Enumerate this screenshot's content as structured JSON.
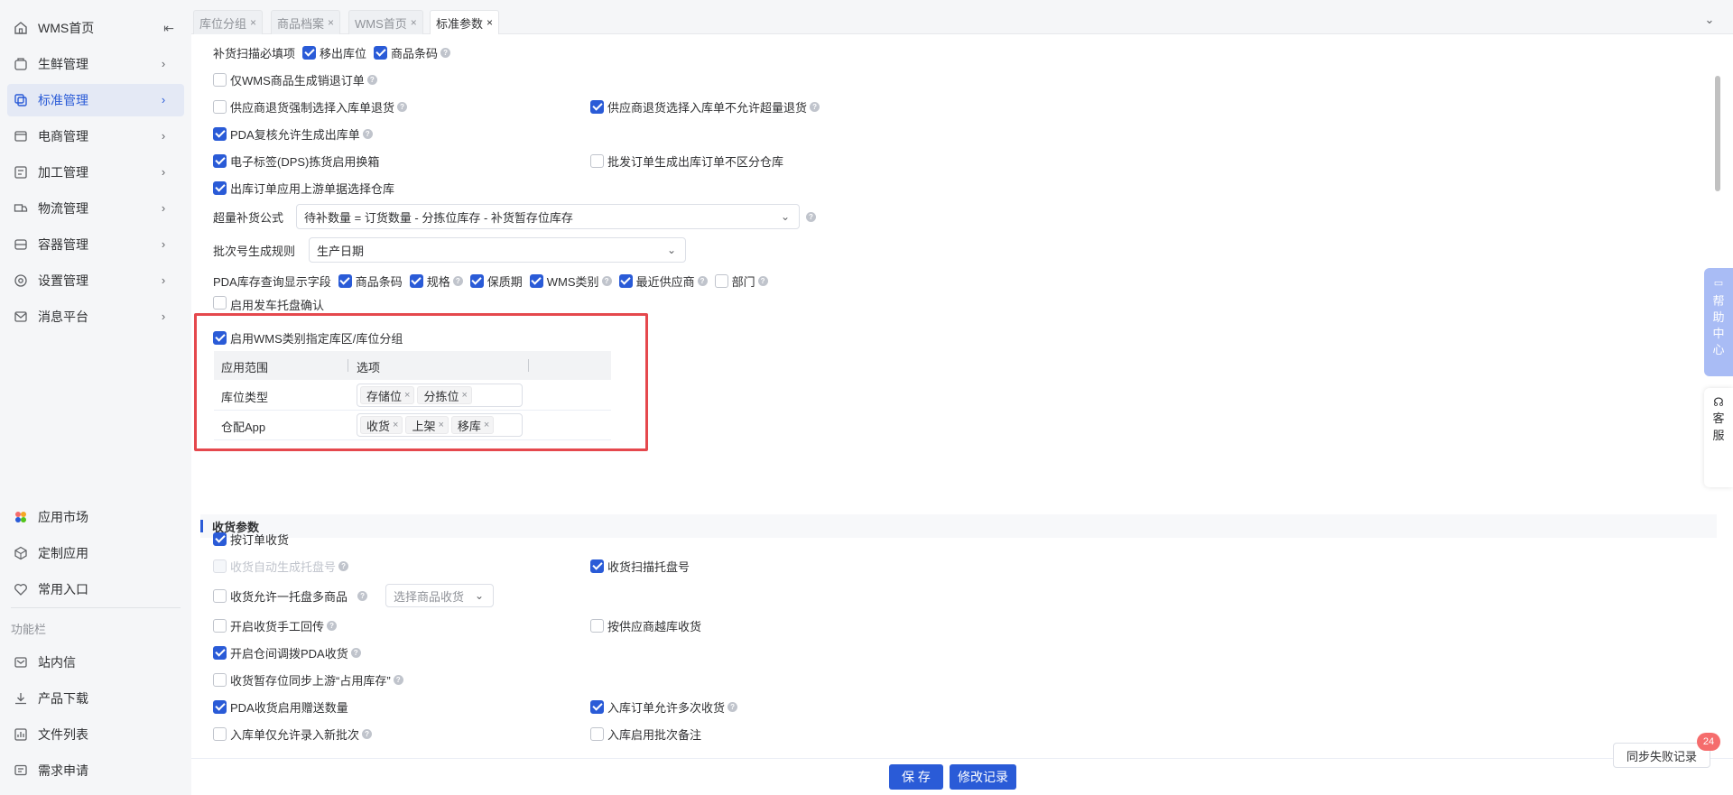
{
  "sidebar": {
    "home": "WMS首页",
    "items": [
      {
        "label": "生鲜管理",
        "icon": "leaf-icon"
      },
      {
        "label": "标准管理",
        "icon": "copy-icon",
        "active": true
      },
      {
        "label": "电商管理",
        "icon": "shop-icon"
      },
      {
        "label": "加工管理",
        "icon": "process-icon"
      },
      {
        "label": "物流管理",
        "icon": "truck-icon"
      },
      {
        "label": "容器管理",
        "icon": "container-icon"
      },
      {
        "label": "设置管理",
        "icon": "settings-icon"
      },
      {
        "label": "消息平台",
        "icon": "mail-icon"
      }
    ],
    "bottom_items": [
      {
        "label": "应用市场",
        "icon": "app-market-icon"
      },
      {
        "label": "定制应用",
        "icon": "cube-icon"
      },
      {
        "label": "常用入口",
        "icon": "heart-icon"
      }
    ],
    "section_title": "功能栏",
    "func_items": [
      {
        "label": "站内信",
        "icon": "inbox-icon"
      },
      {
        "label": "产品下载",
        "icon": "download-icon"
      },
      {
        "label": "文件列表",
        "icon": "chart-file-icon"
      },
      {
        "label": "需求申请",
        "icon": "request-icon"
      }
    ]
  },
  "tabs": [
    {
      "label": "库位分组",
      "active": false
    },
    {
      "label": "商品档案",
      "active": false
    },
    {
      "label": "WMS首页",
      "active": false
    },
    {
      "label": "标准参数",
      "active": true
    }
  ],
  "settings": {
    "replenish_label": "补货扫描必填项",
    "replenish_opt1": "移出库位",
    "replenish_opt2": "商品条码",
    "only_wms": "仅WMS商品生成销退订单",
    "supplier_return_force": "供应商退货强制选择入库单退货",
    "supplier_return_no_over": "供应商退货选择入库单不允许超量退货",
    "pda_review": "PDA复核允许生成出库单",
    "dps_label": "电子标签(DPS)拣货启用换箱",
    "batch_order": "批发订单生成出库订单不区分仓库",
    "outbound_upstream": "出库订单应用上游单据选择仓库",
    "over_formula_label": "超量补货公式",
    "over_formula_value": "待补数量 = 订货数量 - 分拣位库存 - 补货暂存位库存",
    "batch_rule_label": "批次号生成规则",
    "batch_rule_value": "生产日期",
    "pda_display_label": "PDA库存查询显示字段",
    "pda_fields": [
      "商品条码",
      "规格",
      "保质期",
      "WMS类别",
      "最近供应商",
      "部门"
    ],
    "truck_pallet": "启用发车托盘确认",
    "wms_category": "启用WMS类别指定库区/库位分组",
    "table_head_scope": "应用范围",
    "table_head_option": "选项",
    "row1_name": "库位类型",
    "row1_tags": [
      "存储位",
      "分拣位"
    ],
    "row2_name": "仓配App",
    "row2_tags": [
      "收货",
      "上架",
      "移库"
    ]
  },
  "receiving": {
    "title": "收货参数",
    "by_order": "按订单收货",
    "auto_pallet": "收货自动生成托盘号",
    "scan_pallet": "收货扫描托盘号",
    "multi_goods": "收货允许一托盘多商品",
    "multi_goods_placeholder": "选择商品收货",
    "manual_return": "开启收货手工回传",
    "cross_warehouse": "按供应商越库收货",
    "transfer_pda": "开启仓间调拨PDA收货",
    "sync_occupied": "收货暂存位同步上游“占用库存”",
    "pda_gift": "PDA收货启用赠送数量",
    "multi_receive": "入库订单允许多次收货",
    "new_batch_only": "入库单仅允许录入新批次",
    "batch_remark": "入库启用批次备注"
  },
  "footer": {
    "save": "保 存",
    "history": "修改记录",
    "sync_failed": "同步失败记录",
    "badge_count": "24"
  },
  "float": {
    "help_center": [
      "帮",
      "助",
      "中",
      "心"
    ],
    "service": [
      "客",
      "服"
    ]
  },
  "colors": {
    "primary": "#2a5bd7",
    "highlight_border": "#e5484d",
    "badge": "#f56c6c"
  }
}
